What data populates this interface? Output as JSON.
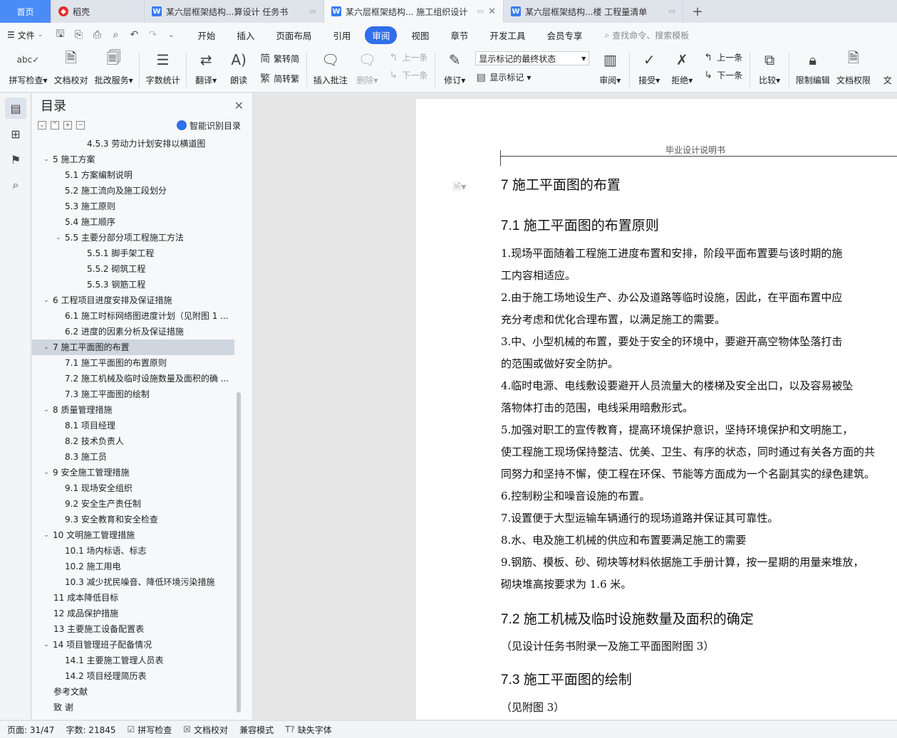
{
  "tabs": {
    "home": "首页",
    "daoke": "稻壳",
    "doc1": "某六层框架结构...算设计 任务书",
    "doc2": "某六层框架结构... 施工组织设计",
    "doc3": "某六层框架结构...楼 工程量清单",
    "new_tab": "+"
  },
  "menu": {
    "file": "文件",
    "items": [
      "开始",
      "插入",
      "页面布局",
      "引用",
      "审阅",
      "视图",
      "章节",
      "开发工具",
      "会员专享"
    ],
    "active": "审阅",
    "search": "查找命令、搜索模板"
  },
  "ribbon": {
    "spell": "拼写检查",
    "doccheck": "文档校对",
    "batch": "批改服务",
    "wordcount": "字数统计",
    "translate": "翻译",
    "read": "朗读",
    "t2s": "繁转简",
    "s2t": "简转繁",
    "insert_comment": "插入批注",
    "delete": "删除",
    "prev1": "上一条",
    "next1": "下一条",
    "revise": "修订",
    "markup_select": "显示标记的最终状态",
    "show_markup": "显示标记",
    "review": "审阅",
    "accept": "接受",
    "reject": "拒绝",
    "prev2": "上一条",
    "next2": "下一条",
    "compare": "比较",
    "restrict": "限制编辑",
    "permission": "文档权限",
    "cut_text": "文"
  },
  "toc": {
    "title": "目录",
    "smart": "智能识别目录",
    "items": [
      {
        "text": "4.5.3  劳动力计划安排以横道图",
        "level": 3,
        "caret": ""
      },
      {
        "text": "5 施工方案",
        "level": 1,
        "caret": "v"
      },
      {
        "text": "5.1  方案编制说明",
        "level": 2,
        "caret": ""
      },
      {
        "text": "5.2 施工流向及施工段划分",
        "level": 2,
        "caret": ""
      },
      {
        "text": "5.3 施工原则",
        "level": 2,
        "caret": ""
      },
      {
        "text": "5.4  施工顺序",
        "level": 2,
        "caret": ""
      },
      {
        "text": "5.5 主要分部分项工程施工方法",
        "level": 2,
        "caret": "v"
      },
      {
        "text": "5.5.1 脚手架工程",
        "level": 3,
        "caret": ""
      },
      {
        "text": "5.5.2 砌筑工程",
        "level": 3,
        "caret": ""
      },
      {
        "text": "5.5.3 钢筋工程",
        "level": 3,
        "caret": ""
      },
      {
        "text": "6 工程项目进度安排及保证措施",
        "level": 1,
        "caret": "v"
      },
      {
        "text": "6.1 施工时标网络图进度计划（见附图 1 ...",
        "level": 2,
        "caret": ""
      },
      {
        "text": "6.2 进度的因素分析及保证措施",
        "level": 2,
        "caret": ""
      },
      {
        "text": "7 施工平面图的布置",
        "level": 1,
        "caret": "v",
        "selected": true
      },
      {
        "text": "7.1 施工平面图的布置原则",
        "level": 2,
        "caret": ""
      },
      {
        "text": "7.2 施工机械及临时设施数量及面积的确 ...",
        "level": 2,
        "caret": ""
      },
      {
        "text": "7.3 施工平面图的绘制",
        "level": 2,
        "caret": ""
      },
      {
        "text": "8 质量管理措施",
        "level": 1,
        "caret": "v"
      },
      {
        "text": "8.1 项目经理",
        "level": 2,
        "caret": ""
      },
      {
        "text": "8.2 技术负责人",
        "level": 2,
        "caret": ""
      },
      {
        "text": "8.3 施工员",
        "level": 2,
        "caret": ""
      },
      {
        "text": "9 安全施工管理措施",
        "level": 1,
        "caret": "v"
      },
      {
        "text": "9.1 现场安全组织",
        "level": 2,
        "caret": ""
      },
      {
        "text": "9.2 安全生产责任制",
        "level": 2,
        "caret": ""
      },
      {
        "text": "9.3 安全教育和安全检查",
        "level": 2,
        "caret": ""
      },
      {
        "text": "10 文明施工管理措施",
        "level": 1,
        "caret": "v"
      },
      {
        "text": "10.1 场内标语、标志",
        "level": 2,
        "caret": ""
      },
      {
        "text": "10.2 施工用电",
        "level": 2,
        "caret": ""
      },
      {
        "text": "10.3 减少扰民噪音、降低环境污染措施",
        "level": 2,
        "caret": ""
      },
      {
        "text": "11 成本降低目标",
        "level": 1,
        "caret": ""
      },
      {
        "text": "12 成品保护措施",
        "level": 1,
        "caret": ""
      },
      {
        "text": "13 主要施工设备配置表",
        "level": 1,
        "caret": ""
      },
      {
        "text": "14 项目管理班子配备情况",
        "level": 1,
        "caret": "v"
      },
      {
        "text": "14.1 主要施工管理人员表",
        "level": 2,
        "caret": ""
      },
      {
        "text": "14.2 项目经理简历表",
        "level": 2,
        "caret": ""
      },
      {
        "text": "参考文献",
        "level": 1,
        "caret": ""
      },
      {
        "text": "致    谢",
        "level": 1,
        "caret": ""
      }
    ]
  },
  "doc": {
    "header": "毕业设计说明书",
    "h_7": "7 施工平面图的布置",
    "h_71": "7.1 施工平面图的布置原则",
    "p1": [
      "    1.现场平面随着工程施工进度布置和安排，阶段平面布置要与该时期的施",
      "工内容相适应。"
    ],
    "p2": [
      "    2.由于施工场地设生产、办公及道路等临时设施，因此，在平面布置中应",
      "充分考虑和优化合理布置，以满足施工的需要。"
    ],
    "p3": [
      "    3.中、小型机械的布置，要处于安全的环境中，要避开高空物体坠落打击",
      "的范围或做好安全防护。"
    ],
    "p4": [
      "   4.临时电源、电线敷设要避开人员流量大的楼梯及安全出口，以及容易被坠",
      "落物体打击的范围，电线采用暗敷形式。"
    ],
    "p5": [
      "   5.加强对职工的宣传教育，提高环境保护意识，坚持环境保护和文明施工，",
      "使工程施工现场保持整洁、优美、卫生、有序的状态，同时通过有关各方面的共",
      "同努力和坚持不懈，使工程在环保、节能等方面成为一个名副其实的绿色建筑。"
    ],
    "p6": "   6.控制粉尘和噪音设施的布置。",
    "p7": "   7.设置便于大型运输车辆通行的现场道路并保证其可靠性。",
    "p8": "   8.水、电及施工机械的供应和布置要满足施工的需要",
    "p9": [
      "   9.钢筋、模板、砂、砌块等材料依据施工手册计算，按一星期的用量来堆放，",
      "砌块堆高按要求为 1.6 米。"
    ],
    "h_72": "7.2 施工机械及临时设施数量及面积的确定",
    "p72": "    （见设计任务书附录一及施工平面图附图 3）",
    "h_73": "7.3 施工平面图的绘制",
    "p73": "    （见附图 3）"
  },
  "status": {
    "page": "页面: 31/47",
    "words": "字数: 21845",
    "spell": "拼写检查",
    "doccheck": "文档校对",
    "compat": "兼容模式",
    "missing_font": "缺失字体"
  }
}
